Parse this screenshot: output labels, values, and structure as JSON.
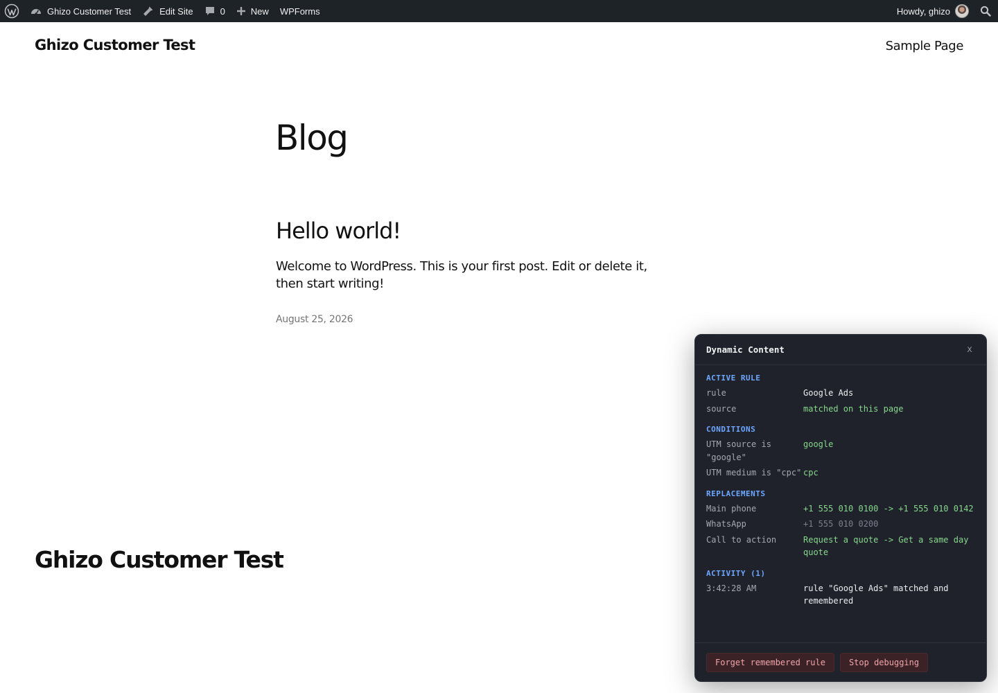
{
  "adminbar": {
    "wp_logo": "wordpress-icon",
    "site_name": "Ghizo Customer Test",
    "edit_site": "Edit Site",
    "comments_count": "0",
    "new_label": "New",
    "wpforms": "WPForms",
    "howdy": "Howdy, ghizo"
  },
  "header": {
    "site_title": "Ghizo Customer Test",
    "nav": [
      "Sample Page"
    ]
  },
  "main": {
    "page_title": "Blog",
    "posts": [
      {
        "title": "Hello world!",
        "excerpt": "Welcome to WordPress. This is your first post. Edit or delete it, then start writing!",
        "date": "August 25, 2026"
      }
    ]
  },
  "footer": {
    "site_title": "Ghizo Customer Test"
  },
  "debug_panel": {
    "title": "Dynamic Content",
    "close": "x",
    "active_rule": {
      "heading": "ACTIVE RULE",
      "rows": [
        {
          "key": "rule",
          "value": "Google Ads"
        },
        {
          "key": "source",
          "value": "matched on this page"
        }
      ]
    },
    "conditions": {
      "heading": "CONDITIONS",
      "rows": [
        {
          "key": "UTM source is \"google\"",
          "value": "google"
        },
        {
          "key": "UTM medium is \"cpc\"",
          "value": "cpc"
        }
      ]
    },
    "replacements": {
      "heading": "REPLACEMENTS",
      "rows": [
        {
          "key": "Main phone",
          "value": "+1 555 010 0100 -> +1 555 010 0142"
        },
        {
          "key": "WhatsApp",
          "value": "+1 555 010 0200"
        },
        {
          "key": "Call to action",
          "value": "Request a quote -> Get a same day quote"
        }
      ]
    },
    "activity": {
      "heading": "ACTIVITY (1)",
      "rows": [
        {
          "key": "3:42:28 AM",
          "value": "rule \"Google Ads\" matched and remembered"
        }
      ]
    },
    "buttons": {
      "forget": "Forget remembered rule",
      "stop": "Stop debugging"
    },
    "colors": {
      "accent_heading": "#6da7ff",
      "value_green": "#86d78b",
      "button_bg": "#3a2227",
      "button_text": "#f2a5a9"
    }
  }
}
